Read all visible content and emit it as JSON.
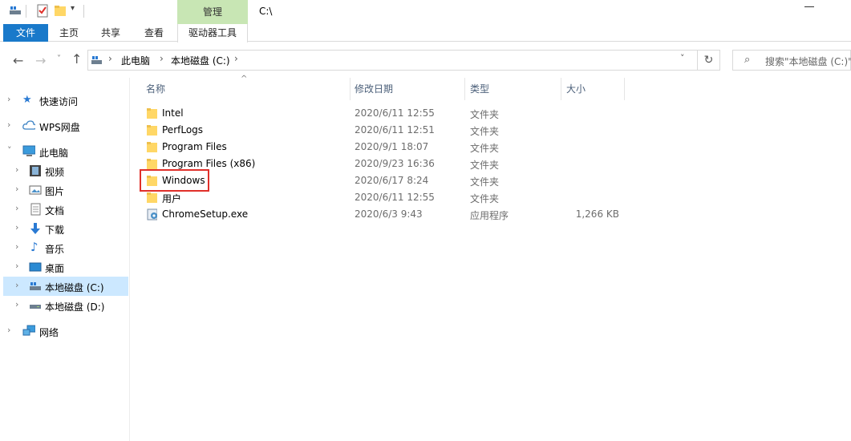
{
  "titlebar": {
    "manage_tab": "管理",
    "path": "C:\\"
  },
  "ribbon": {
    "tabs": [
      "文件",
      "主页",
      "共享",
      "查看"
    ],
    "drive_tools": "驱动器工具"
  },
  "address": {
    "crumbs": [
      "此电脑",
      "本地磁盘 (C:)"
    ],
    "search_placeholder": "搜索\"本地磁盘 (C:)\""
  },
  "nav": {
    "quick_access": "快速访问",
    "wps": "WPS网盘",
    "this_pc": "此电脑",
    "children": [
      "视频",
      "图片",
      "文档",
      "下载",
      "音乐",
      "桌面",
      "本地磁盘 (C:)",
      "本地磁盘 (D:)"
    ],
    "network": "网络"
  },
  "columns": {
    "name": "名称",
    "date": "修改日期",
    "type": "类型",
    "size": "大小"
  },
  "files": [
    {
      "name": "Intel",
      "date": "2020/6/11 12:55",
      "type": "文件夹",
      "size": "",
      "icon": "folder-icon"
    },
    {
      "name": "PerfLogs",
      "date": "2020/6/11 12:51",
      "type": "文件夹",
      "size": "",
      "icon": "folder-icon"
    },
    {
      "name": "Program Files",
      "date": "2020/9/1 18:07",
      "type": "文件夹",
      "size": "",
      "icon": "folder-icon"
    },
    {
      "name": "Program Files (x86)",
      "date": "2020/9/23 16:36",
      "type": "文件夹",
      "size": "",
      "icon": "folder-icon"
    },
    {
      "name": "Windows",
      "date": "2020/6/17 8:24",
      "type": "文件夹",
      "size": "",
      "icon": "folder-icon"
    },
    {
      "name": "用户",
      "date": "2020/6/11 12:55",
      "type": "文件夹",
      "size": "",
      "icon": "folder-icon"
    },
    {
      "name": "ChromeSetup.exe",
      "date": "2020/6/3 9:43",
      "type": "应用程序",
      "size": "1,266 KB",
      "icon": "installer-icon"
    }
  ],
  "colors": {
    "file_tab": "#1979ca",
    "manage_tab": "#c8e6b4",
    "selected": "#cce8ff",
    "highlight": "#e0302a",
    "folder": "#ffd766"
  }
}
